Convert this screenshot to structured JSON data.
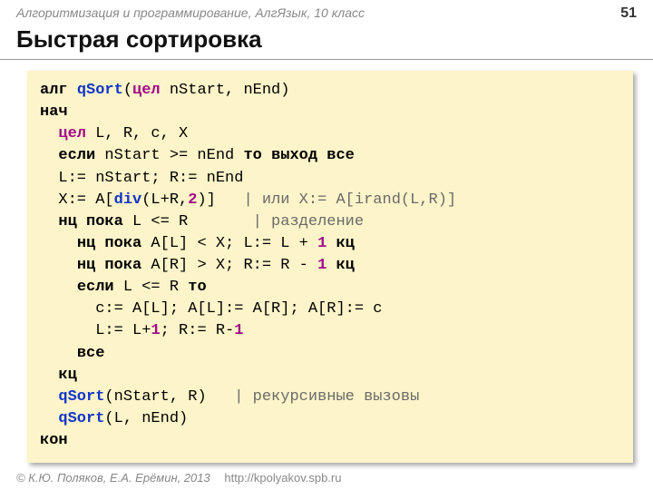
{
  "header": {
    "course": "Алгоритмизация и программирование, АлгЯзык, 10 класс",
    "page": "51"
  },
  "title": "Быстрая сортировка",
  "code": {
    "l1": {
      "alg": "алг ",
      "fn": "qSort",
      "op": "(",
      "ty": "цел",
      "rest": " nStart, nEnd)"
    },
    "l2": "нач",
    "l3": {
      "indent": "  ",
      "ty": "цел",
      "rest": " L, R, c, X"
    },
    "l4": {
      "indent": "  ",
      "kw1": "если",
      "mid": " nStart >= nEnd ",
      "kw2": "то",
      "sp": " ",
      "kw3": "выход",
      "sp2": " ",
      "kw4": "все"
    },
    "l5": "  L:= nStart; R:= nEnd",
    "l6": {
      "indent": "  ",
      "pre": "X:= A[",
      "div": "div",
      "mid": "(L+R,",
      "num": "2",
      "post": ")]   ",
      "cmt": "| или X:= A[irand(L,R)]"
    },
    "l7": {
      "indent": "  ",
      "kw1": "нц",
      "sp": " ",
      "kw2": "пока",
      "mid": " L <= R       ",
      "cmt": "| разделение"
    },
    "l8": {
      "indent": "    ",
      "kw1": "нц",
      "sp": " ",
      "kw2": "пока",
      "mid": " A[L] < X; L:= L + ",
      "num": "1",
      "sp2": " ",
      "kw3": "кц"
    },
    "l9": {
      "indent": "    ",
      "kw1": "нц",
      "sp": " ",
      "kw2": "пока",
      "mid": " A[R] > X; R:= R - ",
      "num": "1",
      "sp2": " ",
      "kw3": "кц"
    },
    "l10": {
      "indent": "    ",
      "kw1": "если",
      "mid": " L <= R ",
      "kw2": "то"
    },
    "l11": "      c:= A[L]; A[L]:= A[R]; A[R]:= c",
    "l12": {
      "indent": "      ",
      "pre": "L:= L+",
      "n1": "1",
      "mid": "; R:= R-",
      "n2": "1"
    },
    "l13": {
      "indent": "    ",
      "kw": "все"
    },
    "l14": {
      "indent": "  ",
      "kw": "кц"
    },
    "l15": {
      "indent": "  ",
      "fn": "qSort",
      "args": "(nStart, R)   ",
      "cmt": "| рекурсивные вызовы"
    },
    "l16": {
      "indent": "  ",
      "fn": "qSort",
      "args": "(L, nEnd)"
    },
    "l17": "кон"
  },
  "footer": {
    "copyright": "© К.Ю. Поляков, Е.А. Ерёмин, 2013",
    "url": "http://kpolyakov.spb.ru"
  }
}
